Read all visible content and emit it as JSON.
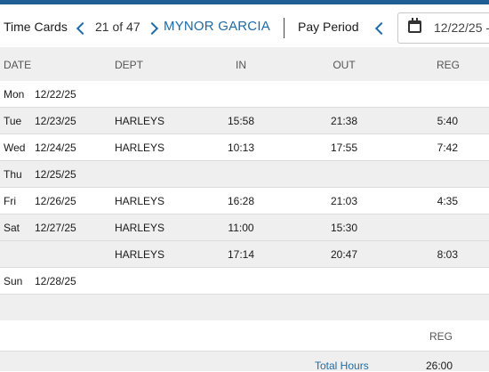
{
  "header": {
    "title": "Time Cards",
    "counter": "21 of 47",
    "employee": "MYNOR GARCIA",
    "pay_period_label": "Pay Period",
    "pay_period_start": "12/22/25 -"
  },
  "columns": {
    "date": "DATE",
    "dept": "DEPT",
    "in": "IN",
    "out": "OUT",
    "reg": "REG"
  },
  "rows": [
    {
      "day": "Mon",
      "date": "12/22/25",
      "dept": "",
      "in": "",
      "out": "",
      "reg": ""
    },
    {
      "day": "Tue",
      "date": "12/23/25",
      "dept": "HARLEYS",
      "in": "15:58",
      "out": "21:38",
      "reg": "5:40"
    },
    {
      "day": "Wed",
      "date": "12/24/25",
      "dept": "HARLEYS",
      "in": "10:13",
      "out": "17:55",
      "reg": "7:42"
    },
    {
      "day": "Thu",
      "date": "12/25/25",
      "dept": "",
      "in": "",
      "out": "",
      "reg": ""
    },
    {
      "day": "Fri",
      "date": "12/26/25",
      "dept": "HARLEYS",
      "in": "16:28",
      "out": "21:03",
      "reg": "4:35"
    },
    {
      "day": "Sat",
      "date": "12/27/25",
      "dept": "HARLEYS",
      "in": "11:00",
      "out": "15:30",
      "reg": ""
    },
    {
      "day": "",
      "date": "",
      "dept": "HARLEYS",
      "in": "17:14",
      "out": "20:47",
      "reg": "8:03"
    },
    {
      "day": "Sun",
      "date": "12/28/25",
      "dept": "",
      "in": "",
      "out": "",
      "reg": ""
    },
    {
      "day": "",
      "date": "",
      "dept": "",
      "in": "",
      "out": "",
      "reg": ""
    }
  ],
  "summary": {
    "reg_label": "REG",
    "total_label": "Total Hours",
    "total_reg": "26:00"
  },
  "colors": {
    "accent": "#1f6aa5",
    "topbar": "#1f5f94",
    "row_gray": "#efefef"
  },
  "icons": {
    "prev_employee": "chevron-left-icon",
    "next_employee": "chevron-right-icon",
    "prev_period": "chevron-left-icon",
    "calendar": "calendar-icon"
  }
}
